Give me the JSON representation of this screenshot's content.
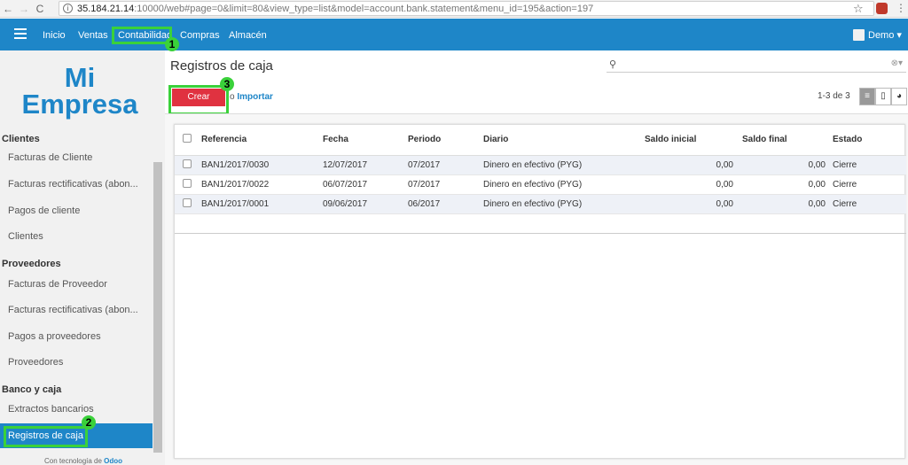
{
  "browser": {
    "back": "←",
    "forward": "→",
    "reload": "C",
    "url_host": "35.184.21.14",
    "url_path": ":10000/web#page=0&limit=80&view_type=list&model=account.bank.statement&menu_id=195&action=197"
  },
  "nav": {
    "items": [
      "Inicio",
      "Ventas",
      "Contabilidad",
      "Compras",
      "Almacén"
    ],
    "user": "Demo ▾",
    "badges": [
      "1",
      "2",
      "3"
    ]
  },
  "sidebar": {
    "logo_line1": "Mi",
    "logo_line2": "Empresa",
    "clientes_section": "Clientes",
    "clientes_items": [
      "Facturas de Cliente",
      "Facturas rectificativas (abon...",
      "Pagos de cliente",
      "Clientes"
    ],
    "proveedores_section": "Proveedores",
    "proveedores_items": [
      "Facturas de Proveedor",
      "Facturas rectificativas (abon...",
      "Pagos a proveedores",
      "Proveedores"
    ],
    "banco_section": "Banco y caja",
    "banco_items": [
      "Extractos bancarios",
      "Registros de caja"
    ],
    "powered_prefix": "Con tecnología de",
    "powered_brand": "Odoo"
  },
  "main": {
    "title": "Registros de caja",
    "create_label": "Crear",
    "import_prefix": "o",
    "import_label": "Importar",
    "pager": "1-3 de 3"
  },
  "table": {
    "headers": [
      "Referencia",
      "Fecha",
      "Periodo",
      "Diario",
      "Saldo inicial",
      "Saldo final",
      "Estado"
    ],
    "rows": [
      [
        "BAN1/2017/0030",
        "12/07/2017",
        "07/2017",
        "Dinero en efectivo (PYG)",
        "0,00",
        "0,00",
        "Cierre"
      ],
      [
        "BAN1/2017/0022",
        "06/07/2017",
        "07/2017",
        "Dinero en efectivo (PYG)",
        "0,00",
        "0,00",
        "Cierre"
      ],
      [
        "BAN1/2017/0001",
        "09/06/2017",
        "06/2017",
        "Dinero en efectivo (PYG)",
        "0,00",
        "0,00",
        "Cierre"
      ]
    ]
  },
  "colors": {
    "brand": "#1e86c8",
    "create": "#e03240",
    "highlight": "#3ad13a"
  }
}
